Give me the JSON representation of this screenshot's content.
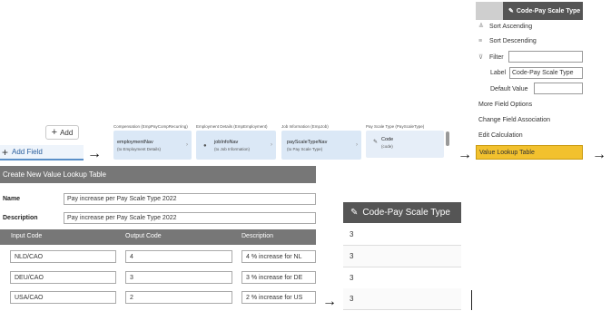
{
  "add_button": {
    "label": "Add",
    "icon": "plus-icon"
  },
  "add_field": {
    "label": "Add Field",
    "icon": "plus-icon"
  },
  "breadcrumb": [
    {
      "header": "Compensation (EmpPayCompRecurring)",
      "title": "employmentNav",
      "subtitle": "(to Employment Details)",
      "icon": ""
    },
    {
      "header": "Employment Details (EmpEmployment)",
      "title": "jobInfoNav",
      "subtitle": "(to Job Information)",
      "icon": "link-icon"
    },
    {
      "header": "Job Information (EmpJob)",
      "title": "payScaleTypeNav",
      "subtitle": "(to Pay Scale Type)",
      "icon": ""
    },
    {
      "header": "Pay Scale Type (PayScaleType)",
      "title": "Code",
      "subtitle": "(code)",
      "icon": "tag-icon"
    }
  ],
  "menu": {
    "header": "Code-Pay Scale Type",
    "header_icon": "tag-icon",
    "sort_ascending": "Sort Ascending",
    "sort_descending": "Sort Descending",
    "filter": "Filter",
    "filter_value": "",
    "label_caption": "Label",
    "label_value": "Code-Pay Scale Type",
    "default_value_caption": "Default Value",
    "default_value": "",
    "more_field_options": "More Field Options",
    "change_field_association": "Change Field Association",
    "edit_calculation": "Edit Calculation",
    "value_lookup_table": "Value Lookup Table"
  },
  "dialog": {
    "title": "Create New Value Lookup Table",
    "name_label": "Name",
    "name_value": "Pay increase per Pay Scale Type 2022",
    "description_label": "Description",
    "description_value": "Pay increase per Pay Scale Type 2022",
    "columns": [
      "Input Code",
      "Output Code",
      "Description"
    ],
    "rows": [
      {
        "input": "NLD/CAO",
        "output": "4",
        "description": "4 % increase for NL"
      },
      {
        "input": "DEU/CAO",
        "output": "3",
        "description": "3 % increase for DE"
      },
      {
        "input": "USA/CAO",
        "output": "2",
        "description": "2 % increase for US"
      }
    ]
  },
  "result_column": {
    "header": "Code-Pay Scale Type",
    "header_icon": "tag-icon",
    "values": [
      "3",
      "3",
      "3",
      "3"
    ]
  },
  "arrows": [
    "→",
    "→",
    "→",
    "→"
  ]
}
